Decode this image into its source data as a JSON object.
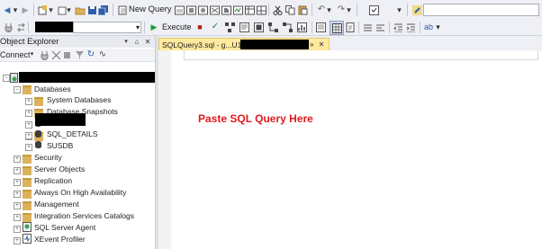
{
  "toolbar": {
    "new_query_label": "New Query",
    "execute_label": "Execute",
    "database_selector_value": ""
  },
  "object_explorer": {
    "title": "Object Explorer",
    "connect_label": "Connect",
    "tree": {
      "databases_label": "Databases",
      "system_databases_label": "System Databases",
      "database_snapshots_label": "Database Snapshots",
      "sql_details_label": "SQL_DETAILS",
      "susdb_label": "SUSDB",
      "security_label": "Security",
      "server_objects_label": "Server Objects",
      "replication_label": "Replication",
      "always_on_label": "Always On High Availability",
      "management_label": "Management",
      "integration_services_label": "Integration Services Catalogs",
      "sql_server_agent_label": "SQL Server Agent",
      "xevent_profiler_label": "XEvent Profiler"
    }
  },
  "editor": {
    "tab_label": "SQLQuery3.sql - g...U1",
    "tab_suffix": "»",
    "tab_close": "✕",
    "annotation": "Paste SQL Query Here",
    "annotation_color": "#e0191e"
  },
  "icons": {
    "back": "◀",
    "forward": "▶",
    "dropdown": "▾",
    "pin": "⌂",
    "close": "✕",
    "expand": "+",
    "collapse": "−",
    "execute": "▶",
    "refresh": "↻",
    "activity": "∿"
  }
}
